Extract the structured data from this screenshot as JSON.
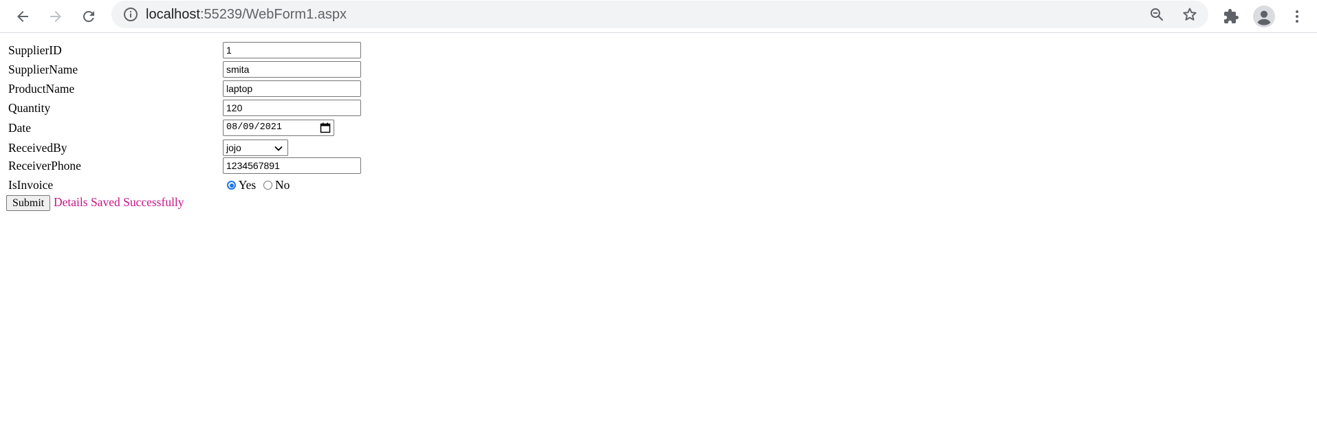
{
  "browser": {
    "url_host": "localhost",
    "url_rest": ":55239/WebForm1.aspx"
  },
  "form": {
    "supplier_id_label": "SupplierID",
    "supplier_id_value": "1",
    "supplier_name_label": "SupplierName",
    "supplier_name_value": "smita",
    "product_name_label": "ProductName",
    "product_name_value": "laptop",
    "quantity_label": "Quantity",
    "quantity_value": "120",
    "date_label": "Date",
    "date_value": "08/09/2021",
    "received_by_label": "ReceivedBy",
    "received_by_value": "jojo",
    "receiver_phone_label": "ReceiverPhone",
    "receiver_phone_value": "1234567891",
    "is_invoice_label": "IsInvoice",
    "is_invoice_options": [
      "Yes",
      "No"
    ],
    "is_invoice_selected": "Yes",
    "submit_label": "Submit",
    "status_message": "Details Saved Successfully"
  },
  "colors": {
    "status_message": "#c71585",
    "radio_checked": "#1a73e8"
  },
  "icons": {
    "back": "back-arrow-icon",
    "forward": "forward-arrow-icon",
    "reload": "reload-icon",
    "info": "info-icon",
    "zoom": "zoom-out-icon",
    "star": "star-icon",
    "extensions": "puzzle-icon",
    "profile": "profile-icon",
    "menu": "kebab-menu-icon"
  }
}
